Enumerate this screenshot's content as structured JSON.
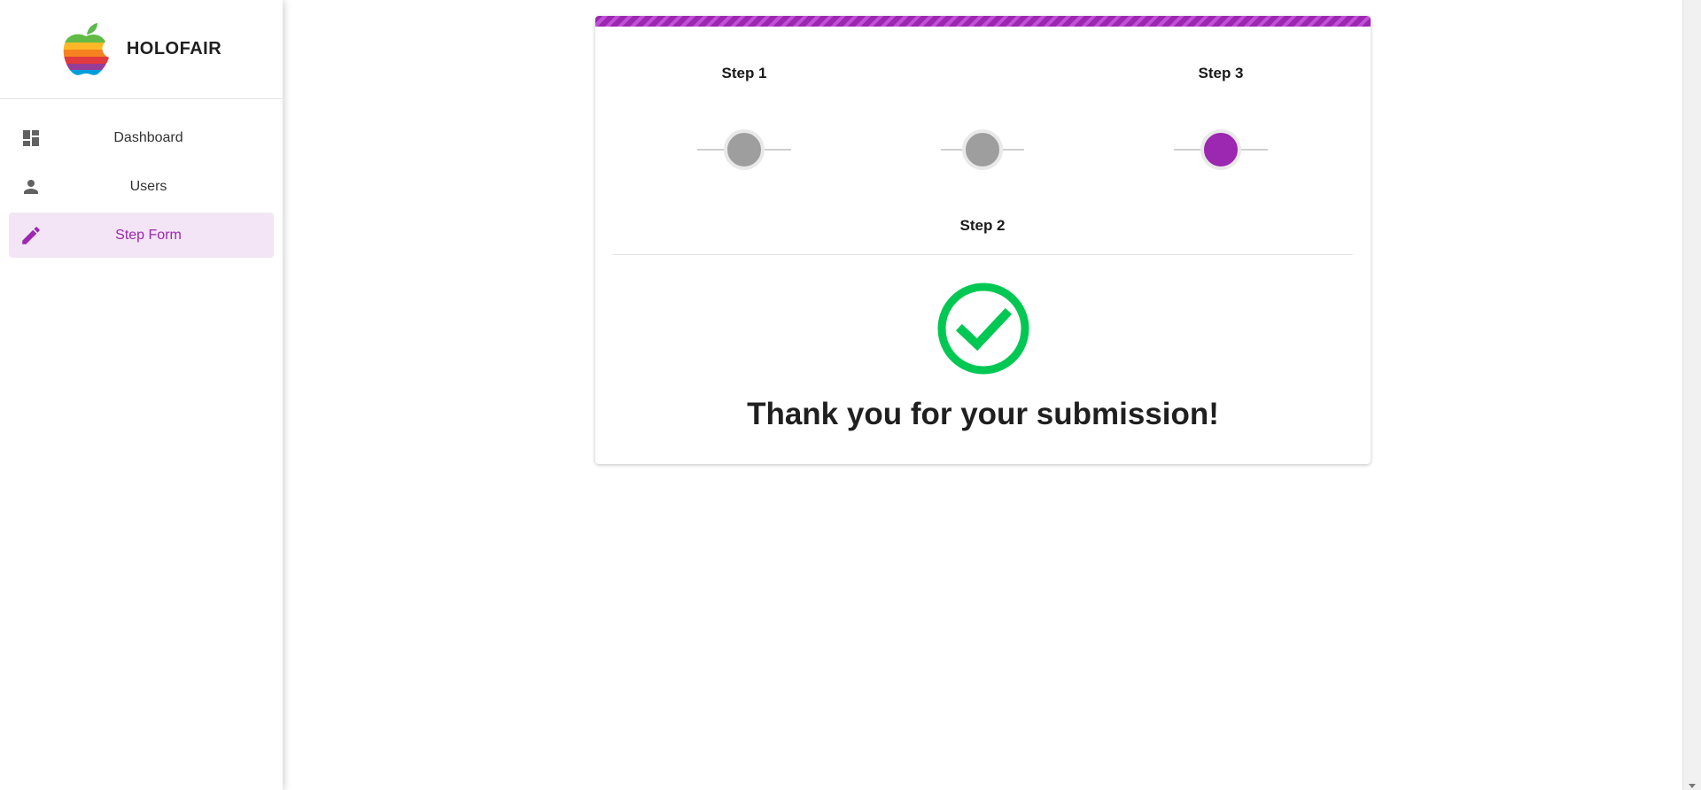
{
  "brand": {
    "name": "HOLOFAIR",
    "logo_icon": "rainbow-apple-logo"
  },
  "sidebar": {
    "items": [
      {
        "label": "Dashboard",
        "icon": "dashboard-icon",
        "active": false
      },
      {
        "label": "Users",
        "icon": "person-icon",
        "active": false
      },
      {
        "label": "Step Form",
        "icon": "pencil-icon",
        "active": true
      }
    ]
  },
  "stepper": {
    "steps": [
      {
        "label": "Step 1",
        "active": false
      },
      {
        "label": "Step 2",
        "active": false
      },
      {
        "label": "Step 3",
        "active": true
      }
    ]
  },
  "result": {
    "message": "Thank you for your submission!",
    "icon": "check-circle-icon"
  },
  "colors": {
    "accent": "#9c27b0",
    "accent_light": "#f3e5f5",
    "success": "#00c853",
    "inactive_step": "#9e9e9e"
  }
}
